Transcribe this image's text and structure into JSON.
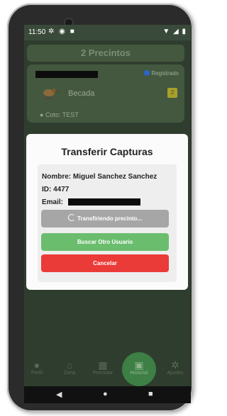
{
  "status_bar": {
    "time": "11:50",
    "left_icons": [
      "settings-icon",
      "app-icon",
      "storage-icon"
    ],
    "right_icons": [
      "wifi-icon",
      "signal-icon",
      "battery-icon"
    ]
  },
  "header": {
    "title": "2 Precintos"
  },
  "card": {
    "badge_label": "Registrado",
    "bird_label": "Becada",
    "tag_value": "2",
    "coto_label": "Coto: TEST"
  },
  "modal": {
    "title": "Transferir Capturas",
    "name_line": "Nombre: Miguel Sanchez Sanchez",
    "id_line": "ID: 4477",
    "email_label": "Email:",
    "progress_label": "Transfiriendo precinto...",
    "search_label": "Buscar Otro Usuario",
    "cancel_label": "Cancelar"
  },
  "bottom_nav": {
    "items": [
      {
        "label": "Perfil",
        "icon": "person-icon"
      },
      {
        "label": "Zona",
        "icon": "home-icon"
      },
      {
        "label": "Precintar",
        "icon": "qr-icon"
      },
      {
        "label": "Historial",
        "icon": "calendar-icon"
      },
      {
        "label": "Ajustes",
        "icon": "gear-icon"
      }
    ],
    "active_index": 3
  },
  "colors": {
    "accent_green": "#6bbd6e",
    "danger_red": "#eb3b38",
    "disabled_gray": "#a6a6a6"
  }
}
